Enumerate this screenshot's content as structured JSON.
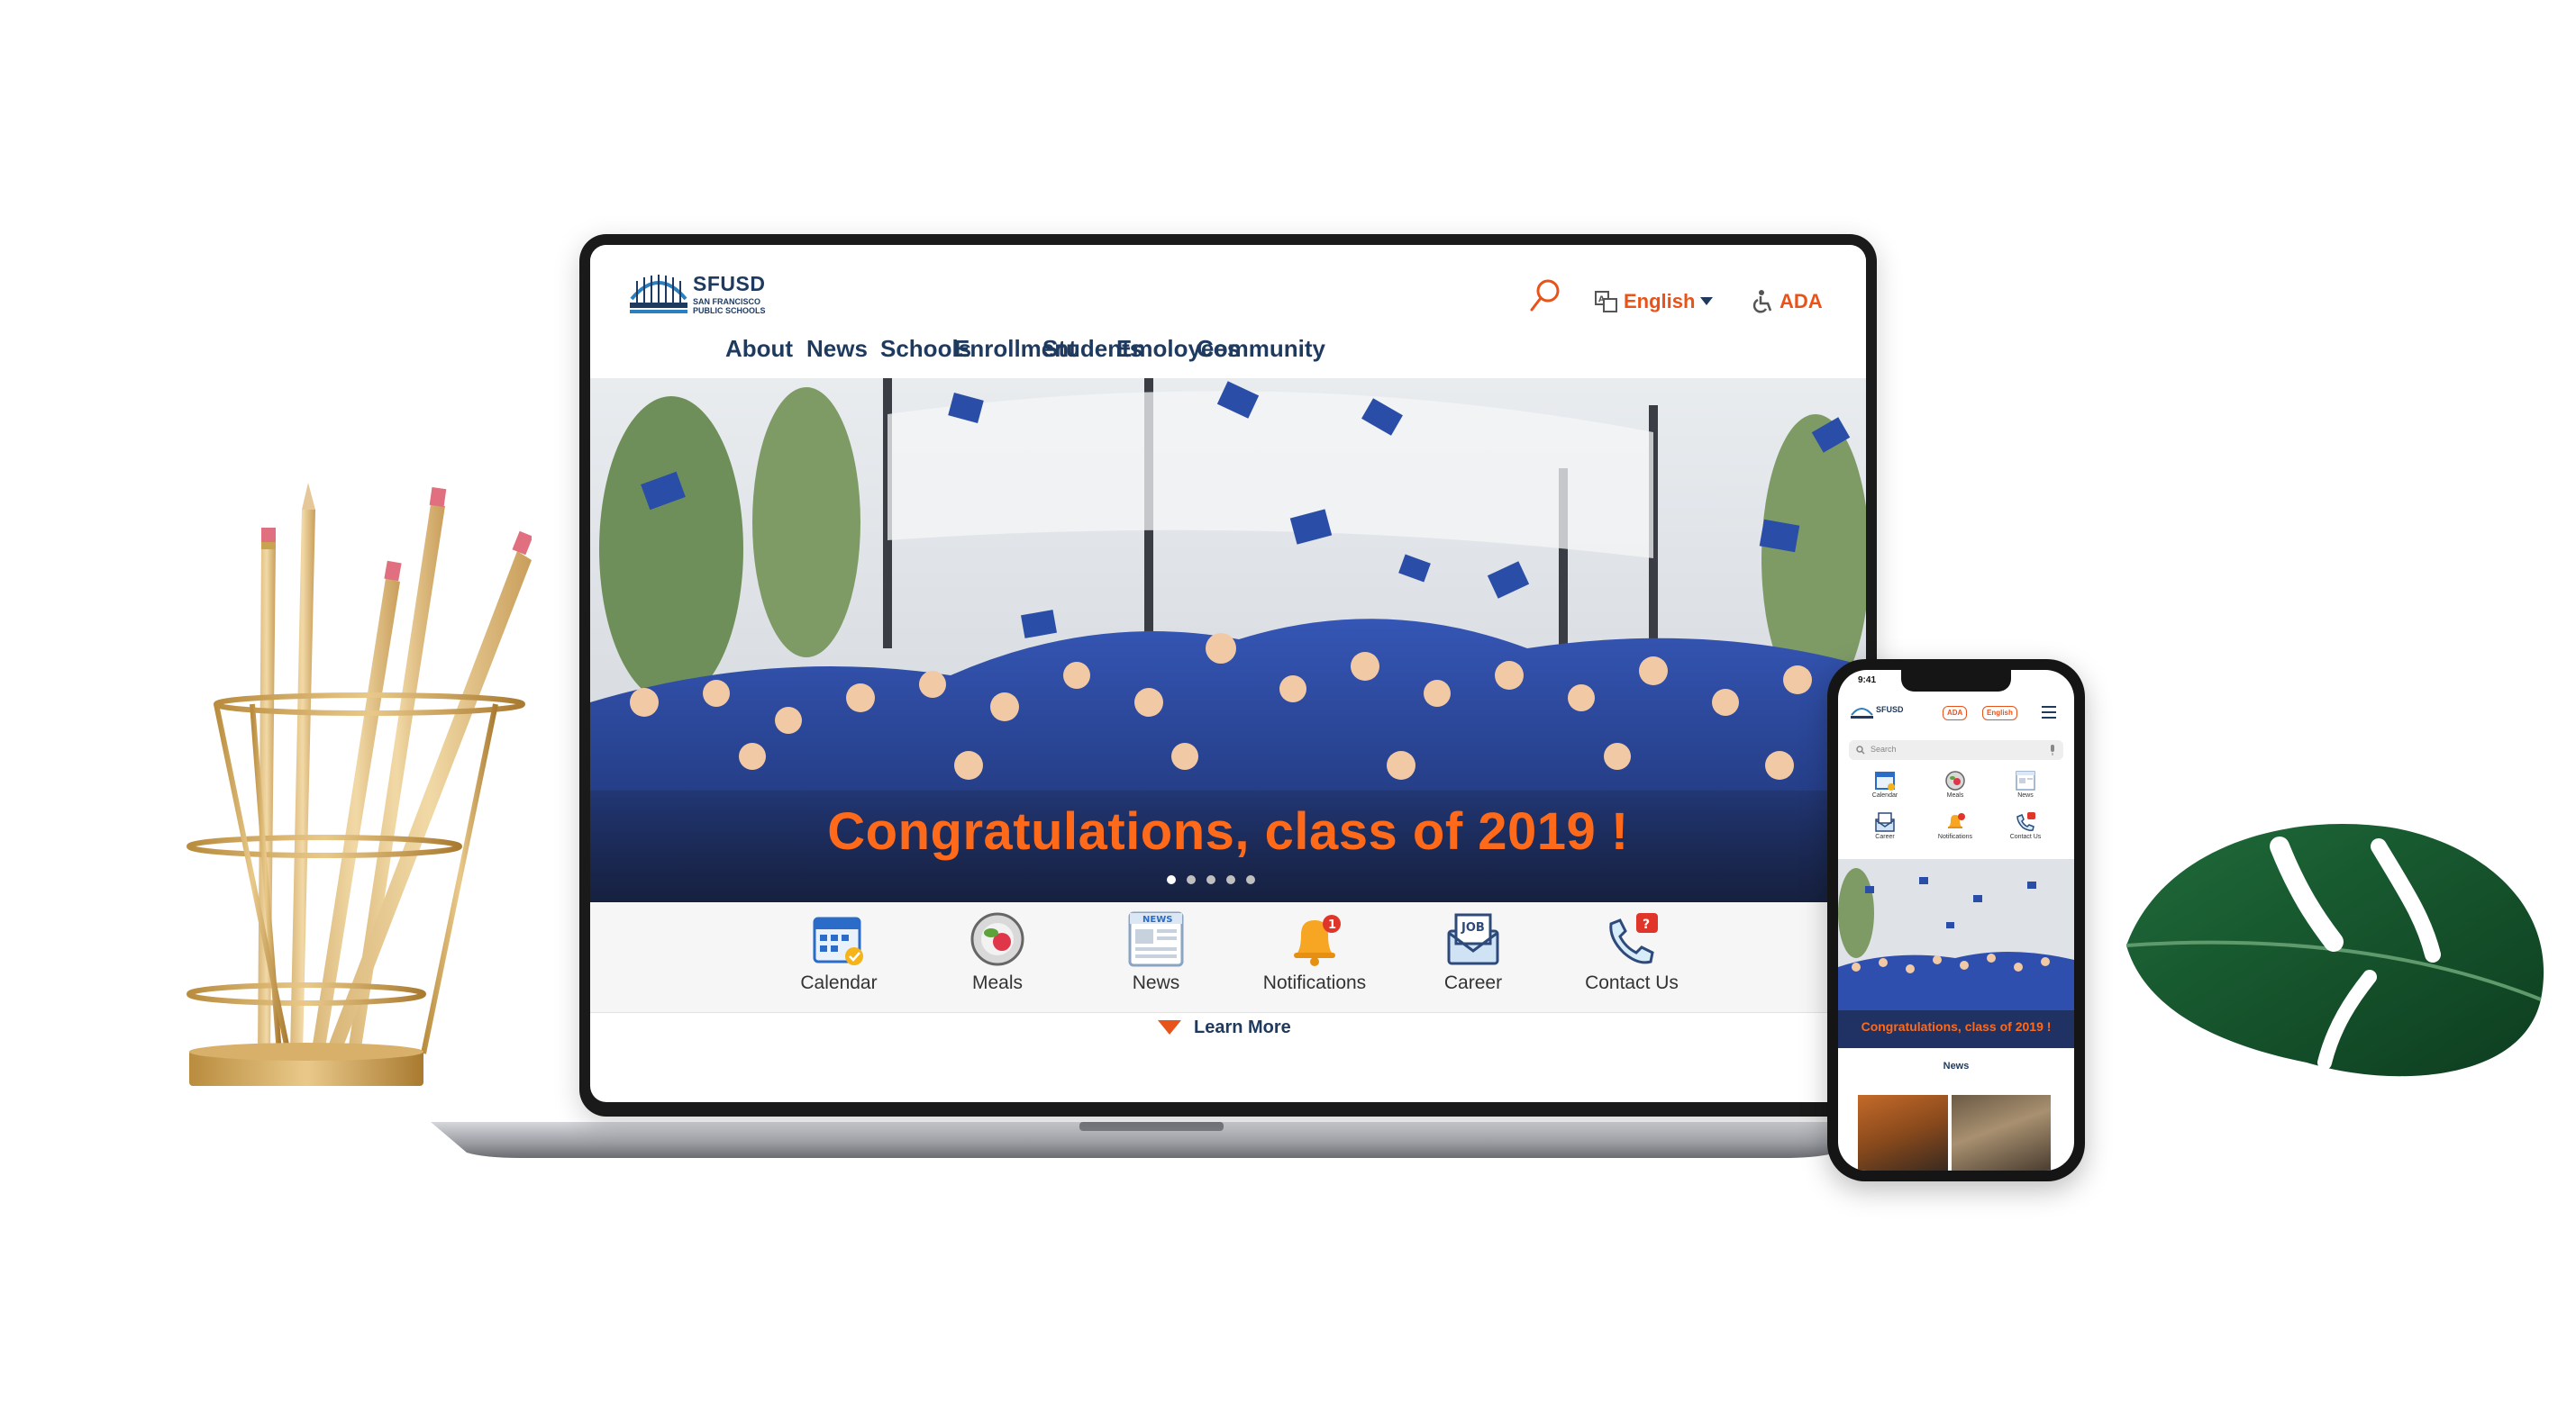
{
  "site": {
    "logo_word": "SFUSD",
    "logo_sub": "SAN FRANCISCO PUBLIC SCHOOLS",
    "language": "English",
    "ada": "ADA"
  },
  "nav": {
    "items": [
      {
        "label": "About"
      },
      {
        "label": "News"
      },
      {
        "label": "Schools"
      },
      {
        "label": "Enrollment"
      },
      {
        "label": "Students"
      },
      {
        "label": "Emoloyees"
      },
      {
        "label": "Community"
      }
    ]
  },
  "hero": {
    "title": "Congratulations, class of 2019 !",
    "slides": 5,
    "active_slide": 0
  },
  "quick_links": [
    {
      "label": "Calendar",
      "icon": "calendar-icon"
    },
    {
      "label": "Meals",
      "icon": "meals-icon"
    },
    {
      "label": "News",
      "icon": "news-icon"
    },
    {
      "label": "Notifications",
      "icon": "notification-bell-icon",
      "badge": "1"
    },
    {
      "label": "Career",
      "icon": "job-envelope-icon"
    },
    {
      "label": "Contact Us",
      "icon": "phone-icon"
    }
  ],
  "learn_more": "Learn More",
  "news_icon_text": "NEWS",
  "career_icon_text": "JOB",
  "phone": {
    "time": "9:41",
    "ada": "ADA",
    "language": "English",
    "search_placeholder": "Search",
    "quick_links": [
      "Calendar",
      "Meals",
      "News",
      "Career",
      "Notifications",
      "Contact Us"
    ],
    "hero_title": "Congratulations, class of 2019 !",
    "section_title": "News"
  },
  "colors": {
    "brand_navy": "#1f3a5f",
    "accent_orange": "#e8531a",
    "gown_blue": "#2a4ea8"
  }
}
